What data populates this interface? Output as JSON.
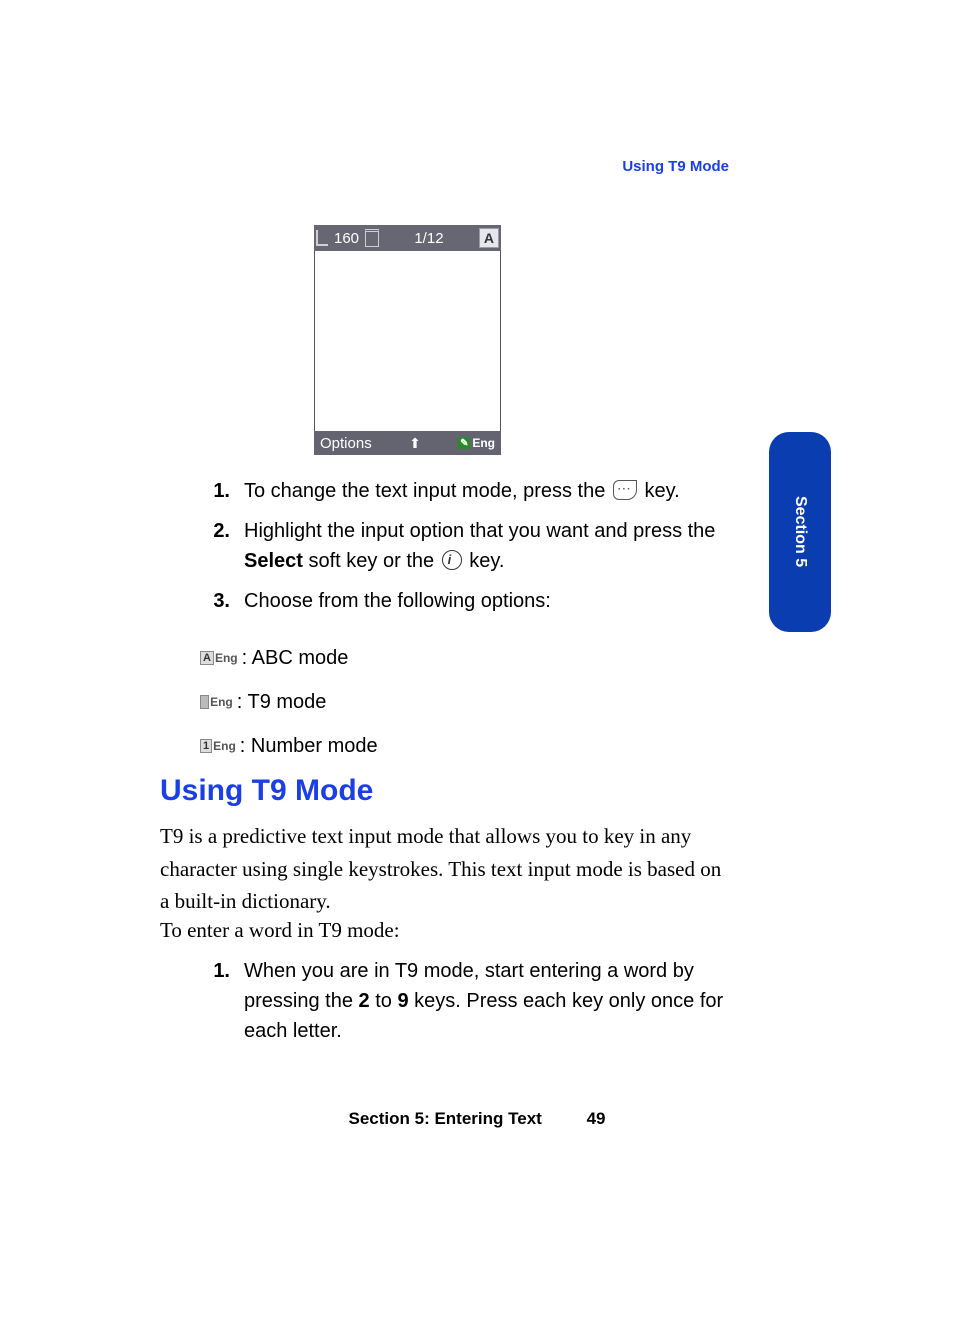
{
  "running_head": "Using T9 Mode",
  "side_tab": "Section 5",
  "page_number": "49",
  "footer_section": "Section 5: Entering Text",
  "phone": {
    "char_count": "160",
    "page_indicator": "1/12",
    "mode_letter": "A",
    "soft_left": "Options",
    "soft_right_label": "Eng"
  },
  "steps_a": {
    "1_pre": "To change the text input mode, press the ",
    "1_post": " key.",
    "2_pre": "Highlight the input option that you want and press the ",
    "2_bold": "Select",
    "2_mid": " soft key or the ",
    "2_post": " key.",
    "3": "Choose from the following options:"
  },
  "modes": {
    "abc_tag_letter": "A",
    "abc_tag_lang": "Eng",
    "abc_label": ": ABC mode",
    "t9_tag_lang": "Eng",
    "t9_label": ": T9 mode",
    "num_tag_letter": "1",
    "num_tag_lang": "Eng",
    "num_label": ": Number mode"
  },
  "heading": "Using T9 Mode",
  "para1": "T9 is a predictive text input mode that allows you to key in any character using single keystrokes. This text input mode is based on a built-in dictionary.",
  "para2": "To enter a word in T9 mode:",
  "steps_b": {
    "1_pre": "When you are in T9 mode, start entering a word by pressing the ",
    "1_b1": "2",
    "1_mid": " to ",
    "1_b2": "9",
    "1_post": " keys. Press each key only once for each letter."
  }
}
